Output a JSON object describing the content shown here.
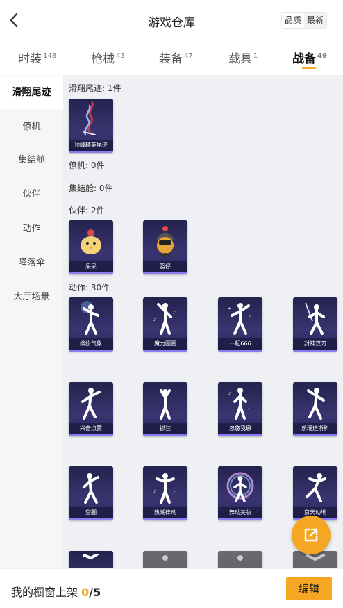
{
  "header": {
    "title": "游戏仓库",
    "sort_quality": "品质",
    "sort_newest": "最新"
  },
  "tabs": [
    {
      "label": "时装",
      "count": "148"
    },
    {
      "label": "枪械",
      "count": "43"
    },
    {
      "label": "装备",
      "count": "47"
    },
    {
      "label": "载具",
      "count": "1"
    },
    {
      "label": "战备",
      "count": "49"
    }
  ],
  "sidebar": [
    "滑翔尾迹",
    "僚机",
    "集结舱",
    "伙伴",
    "动作",
    "降落伞",
    "大厅场景"
  ],
  "sections": {
    "trail": "滑翔尾迹: 1件",
    "wingman": "僚机: 0件",
    "pod": "集结舱: 0件",
    "partner": "伙伴: 2件",
    "emote": "动作: 30件"
  },
  "items": {
    "trail": [
      "顶峰精英尾迹"
    ],
    "partner": [
      "呆呆",
      "盔仔"
    ],
    "emote": [
      "缤纷气象",
      "魔力圈圈",
      "一起666",
      "封神双刀",
      "兴奋点赞",
      "抓狂",
      "忽悠我患",
      "乐瑶迪斯科",
      "空翻",
      "热潮律动",
      "舞动美妆",
      "京天动地"
    ]
  },
  "footer": {
    "label": "我的橱窗上架",
    "shown": "0",
    "total": "/5",
    "edit": "编辑"
  },
  "colors": {
    "accent": "#f5a623",
    "card": "#2a2660"
  }
}
